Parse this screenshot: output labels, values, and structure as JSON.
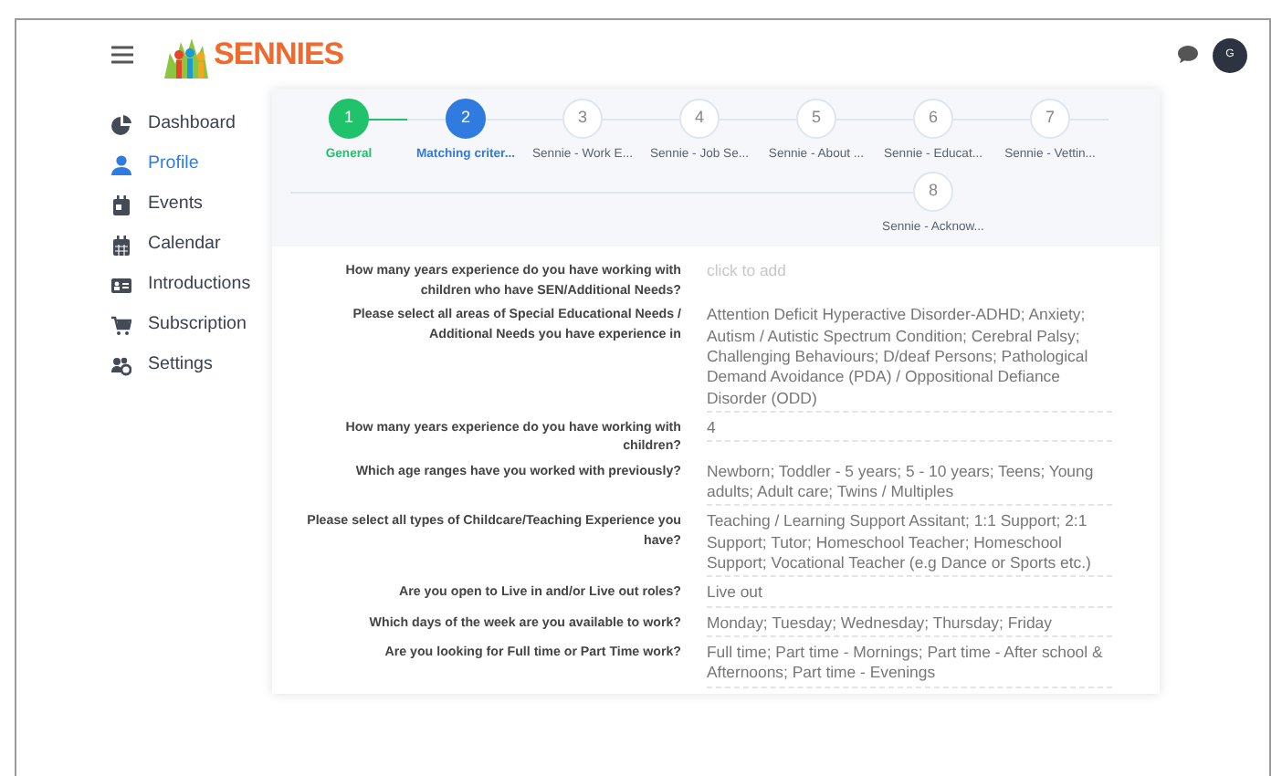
{
  "brand": {
    "name": "SENNIES"
  },
  "sidebar": {
    "items": [
      {
        "label": "Dashboard",
        "selected": false
      },
      {
        "label": "Profile",
        "selected": true
      },
      {
        "label": "Events",
        "selected": false
      },
      {
        "label": "Calendar",
        "selected": false
      },
      {
        "label": "Introductions",
        "selected": false
      },
      {
        "label": "Subscription",
        "selected": false
      },
      {
        "label": "Settings",
        "selected": false
      }
    ]
  },
  "avatar": {
    "initial": "G"
  },
  "steps": [
    {
      "number": "1",
      "label": "General",
      "completed": true,
      "selected": false
    },
    {
      "number": "2",
      "label": "Matching criter...",
      "completed": false,
      "selected": true
    },
    {
      "number": "3",
      "label": "Sennie - Work E...",
      "completed": false,
      "selected": false
    },
    {
      "number": "4",
      "label": "Sennie - Job Se...",
      "completed": false,
      "selected": false
    },
    {
      "number": "5",
      "label": "Sennie - About ...",
      "completed": false,
      "selected": false
    },
    {
      "number": "6",
      "label": "Sennie - Educat...",
      "completed": false,
      "selected": false
    },
    {
      "number": "7",
      "label": "Sennie - Vettin...",
      "completed": false,
      "selected": false
    },
    {
      "number": "8",
      "label": "Sennie - Acknow...",
      "completed": false,
      "selected": false
    }
  ],
  "fields": [
    {
      "label": "How many years experience do you have working with children who have SEN/Additional Needs?",
      "placeholder": "click to add"
    },
    {
      "label": "Please select all areas of Special Educational Needs / Additional Needs you have experience in",
      "value": "Attention Deficit Hyperactive Disorder-ADHD; Anxiety; Autism / Autistic Spectrum Condition; Cerebral Palsy; Challenging Behaviours; D/deaf Persons; Pathological Demand Avoidance (PDA) / Oppositional Defiance Disorder (ODD)"
    },
    {
      "label": "How many years experience do you have working with children?",
      "value": "4"
    },
    {
      "label": "Which age ranges have you worked with previously?",
      "value": "Newborn; Toddler - 5 years; 5 - 10 years; Teens; Young adults; Adult care; Twins / Multiples"
    },
    {
      "label": "Please select all types of Childcare/Teaching Experience you have?",
      "value": "Teaching / Learning Support Assitant; 1:1 Support; 2:1 Support; Tutor; Homeschool Teacher; Homeschool Support; Vocational Teacher (e.g Dance or Sports etc.)"
    },
    {
      "label": "Are you open to Live in and/or Live out roles?",
      "value": "Live out"
    },
    {
      "label": "Which days of the week are you available to work?",
      "value": "Monday; Tuesday; Wednesday; Thursday; Friday"
    },
    {
      "label": "Are you looking for Full time or Part Time work?",
      "value": "Full time; Part time - Mornings; Part time - After school & Afternoons; Part time - Evenings"
    }
  ]
}
